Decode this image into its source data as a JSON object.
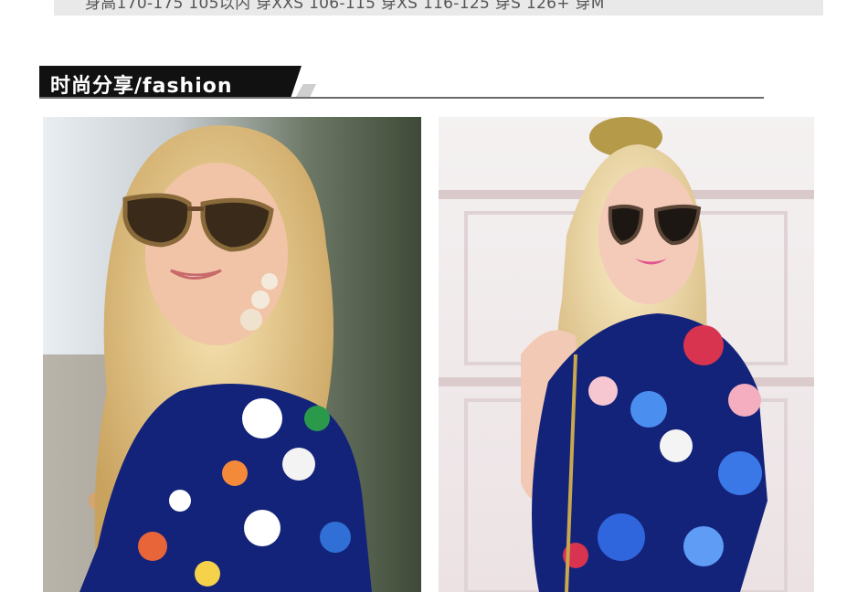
{
  "size_note": {
    "text": "身高170-175 105以内 穿XXS    106-115 穿XS    116-125 穿S  126+ 穿M"
  },
  "section": {
    "title": "时尚分享/fashion"
  },
  "photos": [
    {
      "subject": "woman-tortoiseshell-sunglasses-floral-dress-street"
    },
    {
      "subject": "woman-black-sunglasses-floral-dress-white-door"
    }
  ],
  "colors": {
    "header_bg": "#111111",
    "dress_navy": "#14237a",
    "hair_blonde": "#e7c98c"
  }
}
